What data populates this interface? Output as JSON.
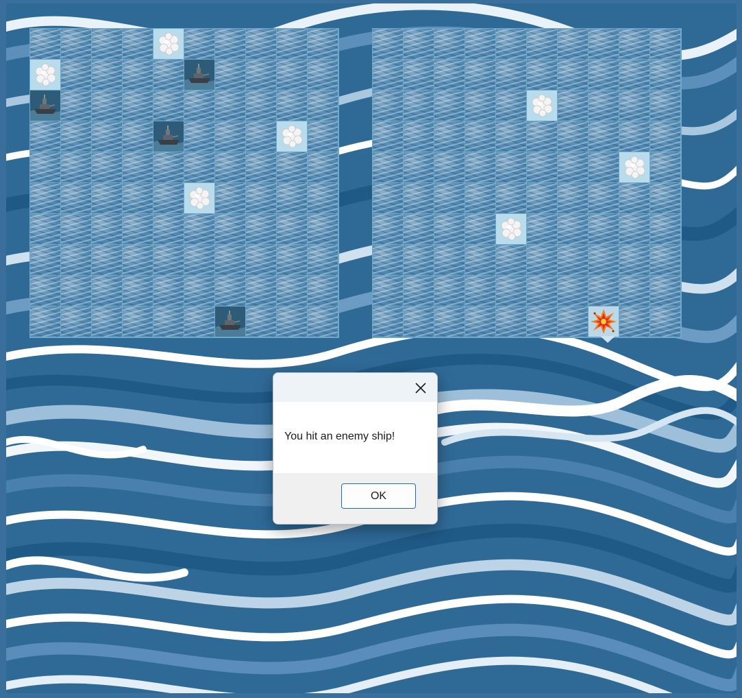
{
  "game": {
    "grid_size": 10,
    "player_board": {
      "cells": [
        [
          "water",
          "water",
          "water",
          "water",
          "miss",
          "water",
          "water",
          "water",
          "water",
          "water"
        ],
        [
          "miss",
          "water",
          "water",
          "water",
          "water",
          "ship",
          "water",
          "water",
          "water",
          "water"
        ],
        [
          "ship",
          "water",
          "water",
          "water",
          "water",
          "water",
          "water",
          "water",
          "water",
          "water"
        ],
        [
          "water",
          "water",
          "water",
          "water",
          "ship",
          "water",
          "water",
          "water",
          "miss",
          "water"
        ],
        [
          "water",
          "water",
          "water",
          "water",
          "water",
          "water",
          "water",
          "water",
          "water",
          "water"
        ],
        [
          "water",
          "water",
          "water",
          "water",
          "water",
          "miss",
          "water",
          "water",
          "water",
          "water"
        ],
        [
          "water",
          "water",
          "water",
          "water",
          "water",
          "water",
          "water",
          "water",
          "water",
          "water"
        ],
        [
          "water",
          "water",
          "water",
          "water",
          "water",
          "water",
          "water",
          "water",
          "water",
          "water"
        ],
        [
          "water",
          "water",
          "water",
          "water",
          "water",
          "water",
          "water",
          "water",
          "water",
          "water"
        ],
        [
          "water",
          "water",
          "water",
          "water",
          "water",
          "water",
          "ship",
          "water",
          "water",
          "water"
        ]
      ]
    },
    "enemy_board": {
      "cells": [
        [
          "water",
          "water",
          "water",
          "water",
          "water",
          "water",
          "water",
          "water",
          "water",
          "water"
        ],
        [
          "water",
          "water",
          "water",
          "water",
          "water",
          "water",
          "water",
          "water",
          "water",
          "water"
        ],
        [
          "water",
          "water",
          "water",
          "water",
          "water",
          "miss",
          "water",
          "water",
          "water",
          "water"
        ],
        [
          "water",
          "water",
          "water",
          "water",
          "water",
          "water",
          "water",
          "water",
          "water",
          "water"
        ],
        [
          "water",
          "water",
          "water",
          "water",
          "water",
          "water",
          "water",
          "water",
          "miss",
          "water"
        ],
        [
          "water",
          "water",
          "water",
          "water",
          "water",
          "water",
          "water",
          "water",
          "water",
          "water"
        ],
        [
          "water",
          "water",
          "water",
          "water",
          "miss",
          "water",
          "water",
          "water",
          "water",
          "water"
        ],
        [
          "water",
          "water",
          "water",
          "water",
          "water",
          "water",
          "water",
          "water",
          "water",
          "water"
        ],
        [
          "water",
          "water",
          "water",
          "water",
          "water",
          "water",
          "water",
          "water",
          "water",
          "water"
        ],
        [
          "water",
          "water",
          "water",
          "water",
          "water",
          "water",
          "water",
          "hit",
          "water",
          "water"
        ]
      ]
    },
    "icons": {
      "water": "wave-icon",
      "miss": "splash-icon",
      "ship": "battleship-icon",
      "hit": "explosion-icon"
    }
  },
  "dialog": {
    "message": "You hit an enemy ship!",
    "ok_label": "OK",
    "close_icon": "close-icon"
  },
  "colors": {
    "ocean": "#2f6a97",
    "water_cell": "#4f86b0",
    "miss_cell": "#b9dcec",
    "ok_border": "#1a6fc4"
  }
}
